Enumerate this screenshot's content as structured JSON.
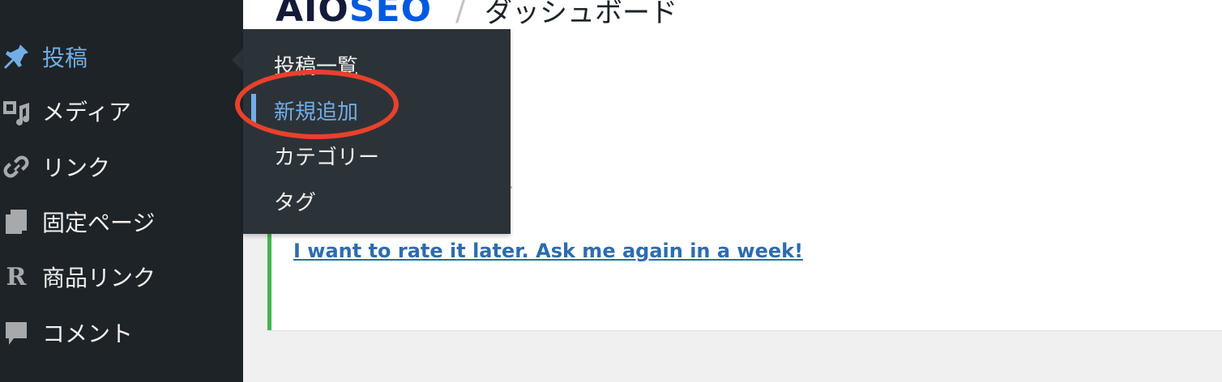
{
  "header": {
    "logo_aio": "AIO",
    "logo_seo": "SEO",
    "separator": "/",
    "page_title": "ダッシュボード"
  },
  "sidebar": {
    "items": [
      {
        "label": "投稿",
        "icon": "pin-icon",
        "active": true
      },
      {
        "label": "メディア",
        "icon": "media-icon"
      },
      {
        "label": "リンク",
        "icon": "link-icon"
      },
      {
        "label": "固定ページ",
        "icon": "pages-icon"
      },
      {
        "label": "商品リンク",
        "icon": "rinker-r-icon"
      },
      {
        "label": "コメント",
        "icon": "comment-icon"
      }
    ]
  },
  "flyout": {
    "items": [
      {
        "label": "投稿一覧"
      },
      {
        "label": "新規追加",
        "current": true
      },
      {
        "label": "カテゴリー"
      },
      {
        "label": "タグ"
      }
    ]
  },
  "notice": {
    "later_link": "I want to rate it later. Ask me again in a week!"
  },
  "colors": {
    "sidebar_bg": "#1d2327",
    "flyout_bg": "#2c3338",
    "accent": "#72aee6",
    "notice_border": "#46b450",
    "link": "#2e6cae",
    "highlight_ring": "#e8412c"
  }
}
